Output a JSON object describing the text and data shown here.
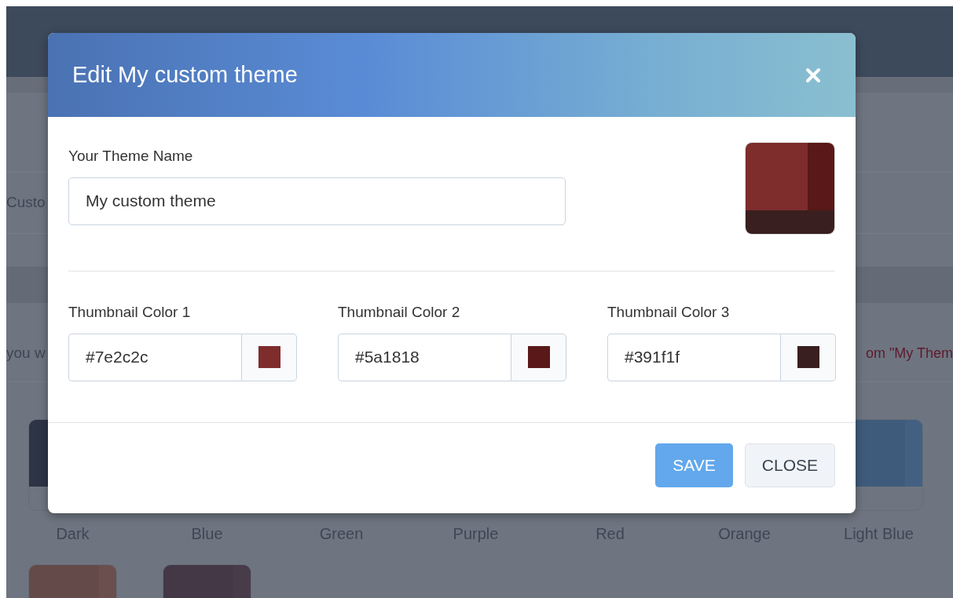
{
  "background": {
    "list_item_label": "Custo",
    "notice_text": "you w",
    "notice_link": "om \"My Them",
    "themes": [
      {
        "name": "Dark",
        "color": "#2d3446"
      },
      {
        "name": "Blue"
      },
      {
        "name": "Green"
      },
      {
        "name": "Purple"
      },
      {
        "name": "Red"
      },
      {
        "name": "Orange"
      },
      {
        "name": "Light Blue",
        "color": "#3f5b7b"
      }
    ],
    "more_themes": [
      {
        "color": "#654a4a"
      },
      {
        "color": "#443846"
      }
    ]
  },
  "modal": {
    "title": "Edit My custom theme",
    "name_field": {
      "label": "Your Theme Name",
      "value": "My custom theme"
    },
    "thumbnail_colors": [
      {
        "label": "Thumbnail Color 1",
        "value": "#7e2c2c",
        "color": "#7e2c2c"
      },
      {
        "label": "Thumbnail Color 2",
        "value": "#5a1818",
        "color": "#5a1818"
      },
      {
        "label": "Thumbnail Color 3",
        "value": "#391f1f",
        "color": "#391f1f"
      }
    ],
    "buttons": [
      {
        "label": "SAVE",
        "kind": "primary"
      },
      {
        "label": "CLOSE",
        "kind": "secondary"
      }
    ]
  }
}
